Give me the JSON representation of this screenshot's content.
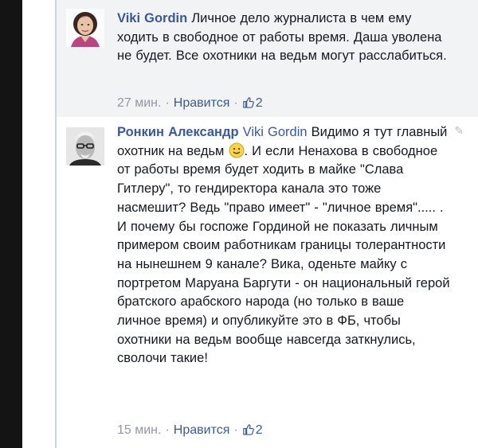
{
  "comments": [
    {
      "author": "Viki Gordin",
      "text": "Личное дело журналиста в чем ему ходить в свободное от работы время. Даша уволена не будет. Все охотники на ведьм могут расслабиться.",
      "time": "27 мин.",
      "like_label": "Нравится",
      "like_count": "2"
    },
    {
      "author": "Ронкин Александр",
      "mention": "Viki Gordin",
      "text_before_smiley": "Видимо я тут главный охотник на ведьм",
      "text_after_smiley": ". И если Ненахова в свободное от работы время будет ходить в майке \"Слава Гитлеру\", то гендиректора канала это тоже насмешит? Ведь \"право имеет\" - \"личное время\"..... . И почему бы госпоже Гординой не показать личным примером своим работникам границы толерантности на нынешнем 9 канале? Вика, оденьте майку с портретом Маруана Баргути - он национальный герой братского арабского народа (но только в ваше личное время) и опубликуйте это в ФБ, чтобы охотники на ведьм вообще навсегда заткнулись, сволочи такие!",
      "time": "15 мин.",
      "like_label": "Нравится",
      "like_count": "2"
    }
  ],
  "colors": {
    "link": "#3b5998",
    "meta": "#9197a3",
    "text": "#141823",
    "first_comment_bg": "#f2f3f5"
  },
  "icons": [
    "smiley-icon",
    "thumbs-up-icon",
    "edit-pencil-icon"
  ]
}
